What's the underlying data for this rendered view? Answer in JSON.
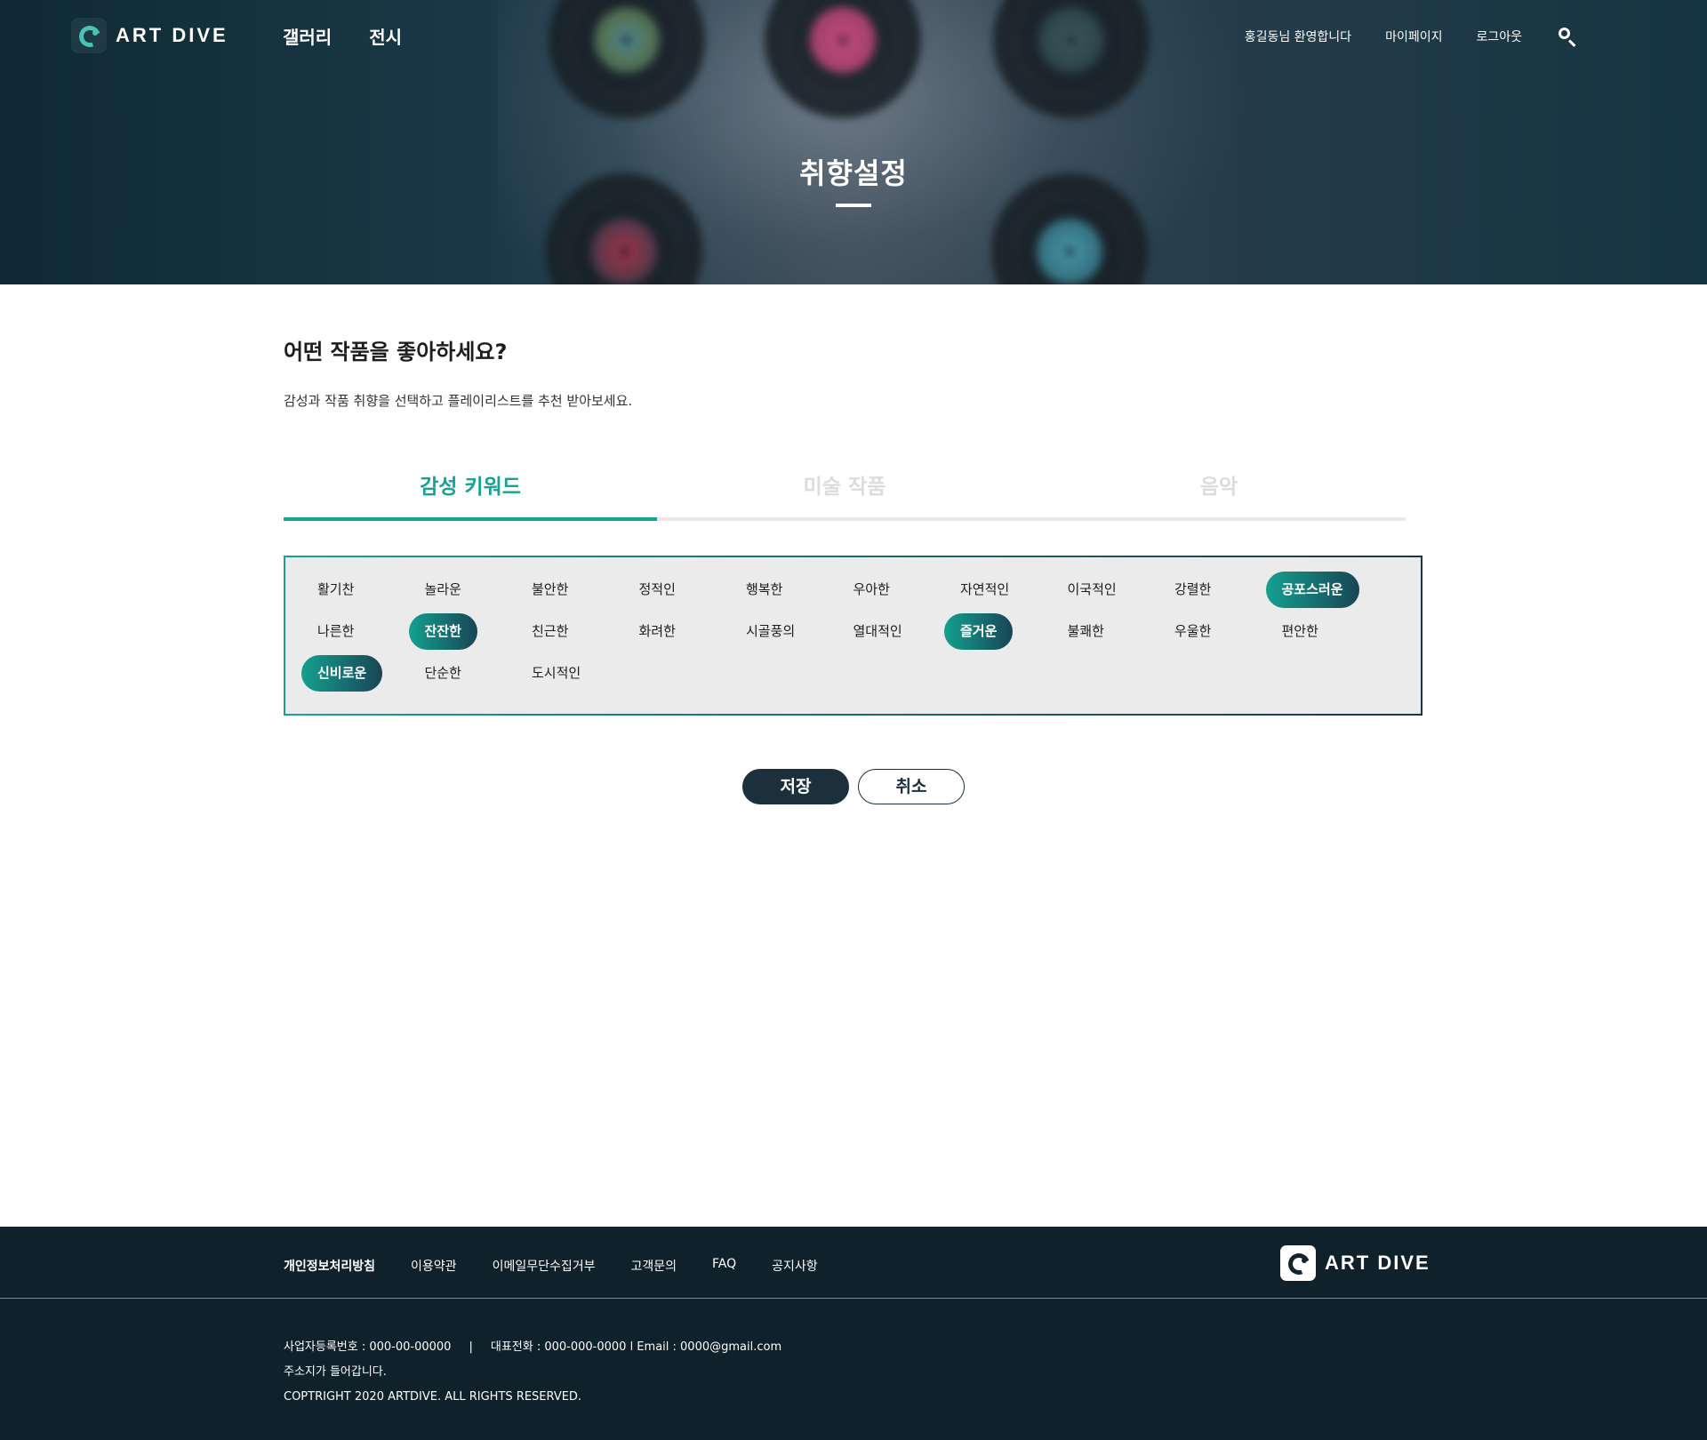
{
  "header": {
    "logo_text": "ART DIVE",
    "nav": [
      "갤러리",
      "전시"
    ],
    "greeting": "홍길동님 환영합니다",
    "mypage": "마이페이지",
    "logout": "로그아웃",
    "search_icon": "search-icon"
  },
  "hero": {
    "title": "취향설정"
  },
  "main": {
    "headline": "어떤 작품을 좋아하세요?",
    "description": "감성과 작품 취향을 선택하고 플레이리스트를 추천 받아보세요.",
    "tabs": [
      {
        "label": "감성 키워드",
        "active": true
      },
      {
        "label": "미술 작품",
        "active": false
      },
      {
        "label": "음악",
        "active": false
      }
    ],
    "keywords": [
      {
        "label": "활기찬",
        "selected": false
      },
      {
        "label": "놀라운",
        "selected": false
      },
      {
        "label": "불안한",
        "selected": false
      },
      {
        "label": "정적인",
        "selected": false
      },
      {
        "label": "행복한",
        "selected": false
      },
      {
        "label": "우아한",
        "selected": false
      },
      {
        "label": "자연적인",
        "selected": false
      },
      {
        "label": "이국적인",
        "selected": false
      },
      {
        "label": "강렬한",
        "selected": false
      },
      {
        "label": "공포스러운",
        "selected": true
      },
      {
        "label": "나른한",
        "selected": false
      },
      {
        "label": "잔잔한",
        "selected": true
      },
      {
        "label": "친근한",
        "selected": false
      },
      {
        "label": "화려한",
        "selected": false
      },
      {
        "label": "시골풍의",
        "selected": false
      },
      {
        "label": "열대적인",
        "selected": false
      },
      {
        "label": "즐거운",
        "selected": true
      },
      {
        "label": "불쾌한",
        "selected": false
      },
      {
        "label": "우울한",
        "selected": false
      },
      {
        "label": "편안한",
        "selected": false
      },
      {
        "label": "신비로운",
        "selected": true
      },
      {
        "label": "단순한",
        "selected": false
      },
      {
        "label": "도시적인",
        "selected": false
      }
    ],
    "save_label": "저장",
    "cancel_label": "취소"
  },
  "footer": {
    "links": [
      "개인정보처리방침",
      "이용약관",
      "이메일무단수집거부",
      "고객문의",
      "FAQ",
      "공지사항"
    ],
    "logo_text": "ART DIVE",
    "business_no": "사업자등록번호 : 000-00-00000",
    "sep": "|",
    "contact": "대표전화 : 000-000-0000  l Email : 0000@gmail.com",
    "address": "주소지가 들어갑니다.",
    "copyright": "COPTRIGHT 2020 ARTDIVE. ALL RIGHTS RESERVED."
  },
  "colors": {
    "accent": "#17a392",
    "dark": "#1c303c",
    "footer_bg": "#0f212a",
    "chip_bg": "#ebebeb"
  }
}
